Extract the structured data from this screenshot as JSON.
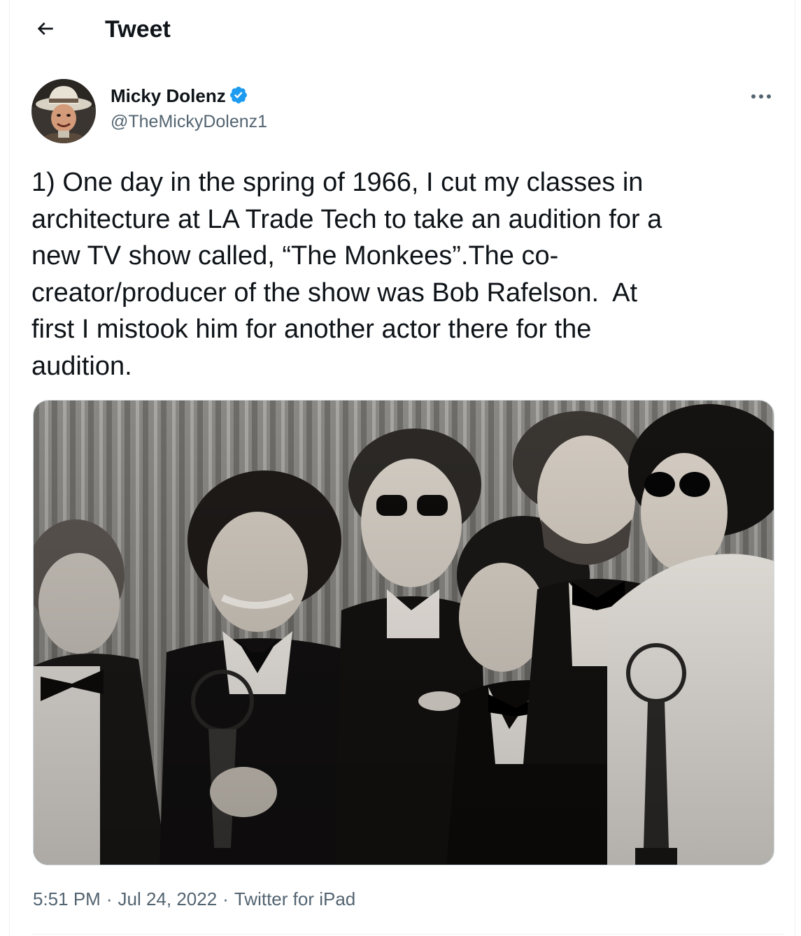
{
  "header": {
    "title": "Tweet",
    "back_icon": "arrow-left-icon"
  },
  "author": {
    "name": "Micky Dolenz",
    "handle": "@TheMickyDolenz1",
    "verified": true,
    "verified_color": "#1d9bf0",
    "avatar_icon": "profile-photo"
  },
  "tweet": {
    "text": "1) One day in the spring of 1966, I cut my classes in\narchitecture at LA Trade Tech to take an audition for a\nnew TV show called, “The Monkees”.The co-\ncreator/producer of the show was Bob Rafelson.  At\nfirst I mistook him for another actor there for the\naudition.",
    "media": {
      "type": "photo",
      "style": "black-and-white",
      "icon": "group-photo"
    }
  },
  "meta": {
    "time": "5:51 PM",
    "separator": "·",
    "date": "Jul 24, 2022",
    "source": "Twitter for iPad"
  },
  "colors": {
    "text": "#0f1419",
    "secondary": "#536471",
    "border": "#eff3f4",
    "accent": "#1d9bf0"
  }
}
